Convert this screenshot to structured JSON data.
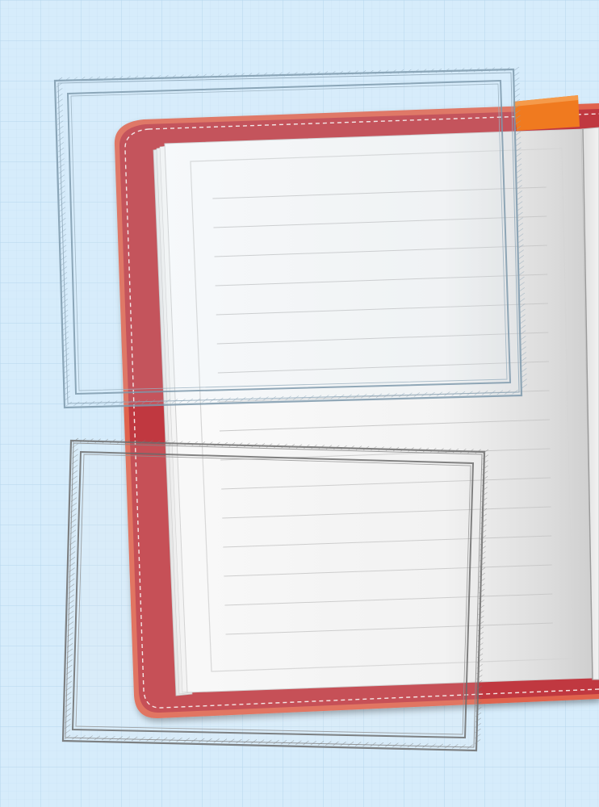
{
  "scene": {
    "background_color": "#d6ecfb",
    "grid_color": "#b9d8ee",
    "notebook_cover_color": "#c0383f",
    "notebook_cover_edge_color": "#e0644d",
    "stitching_color": "#f7e6e4",
    "paper_color": "#f4f4f4",
    "rule_line_color": "#c9c9c9",
    "bookmark_color": "#f07a1f",
    "sketch_frame_top_color": "#7f9aad",
    "sketch_frame_bottom_color": "#6e6e6e"
  },
  "elements": {
    "background": "graph-paper-background",
    "notebook": "open-notebook",
    "bookmark": "bookmark-ribbon",
    "frame_top": "sketched-frame-top",
    "frame_bottom": "sketched-frame-bottom"
  },
  "text": {}
}
